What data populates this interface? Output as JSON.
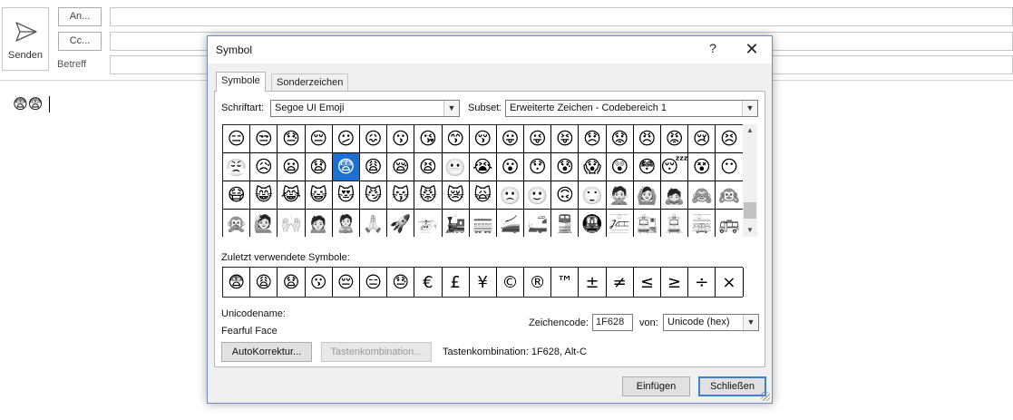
{
  "compose": {
    "send_label": "Senden",
    "to_label": "An...",
    "cc_label": "Cc...",
    "subject_label": "Betreff",
    "body_text": "😨😨"
  },
  "dialog": {
    "title": "Symbol",
    "help": "?",
    "close": "✕",
    "tabs": [
      "Symbole",
      "Sonderzeichen"
    ],
    "font_label": "Schriftart:",
    "font_value": "Segoe UI Emoji",
    "subset_label": "Subset:",
    "subset_value": "Erweiterte Zeichen - Codebereich 1",
    "symbols": [
      "😑",
      "😒",
      "😓",
      "😔",
      "😕",
      "😖",
      "😗",
      "😘",
      "😙",
      "😚",
      "😛",
      "😜",
      "😝",
      "😞",
      "😟",
      "😠",
      "😡",
      "😢",
      "😣",
      "😤",
      "😥",
      "😦",
      "😧",
      "😨",
      "😩",
      "😪",
      "😫",
      "😬",
      "😭",
      "😮",
      "😯",
      "😰",
      "😱",
      "😲",
      "😳",
      "😴",
      "😵",
      "😶",
      "😷",
      "😸",
      "😹",
      "😺",
      "😻",
      "😼",
      "😽",
      "😾",
      "😿",
      "🙀",
      "🙁",
      "🙂",
      "🙃",
      "🙄",
      "🙅",
      "🙆",
      "🙇",
      "🙈",
      "🙉",
      "🙊",
      "🙋",
      "🙌",
      "🙍",
      "🙎",
      "🙏",
      "🚀",
      "🚁",
      "🚂",
      "🚃",
      "🚄",
      "🚅",
      "🚆",
      "🚇",
      "🚈",
      "🚉",
      "🚊",
      "🚋",
      "🚌"
    ],
    "selected_index": 23,
    "recent_label": "Zuletzt verwendete Symbole:",
    "recent": [
      "😨",
      "😩",
      "😧",
      "😗",
      "😔",
      "😑",
      "😓",
      "€",
      "£",
      "¥",
      "©",
      "®",
      "™",
      "±",
      "≠",
      "≤",
      "≥",
      "÷",
      "×"
    ],
    "unicode_name_label": "Unicodename:",
    "unicode_name": "Fearful Face",
    "char_code_label": "Zeichencode:",
    "char_code": "1F628",
    "from_label": "von:",
    "from_value": "Unicode (hex)",
    "autocorrect_label": "AutoKorrektur...",
    "shortcut_button_label": "Tastenkombination...",
    "shortcut_text": "Tastenkombination: 1F628, Alt-C",
    "insert_label": "Einfügen",
    "close_label": "Schließen"
  }
}
